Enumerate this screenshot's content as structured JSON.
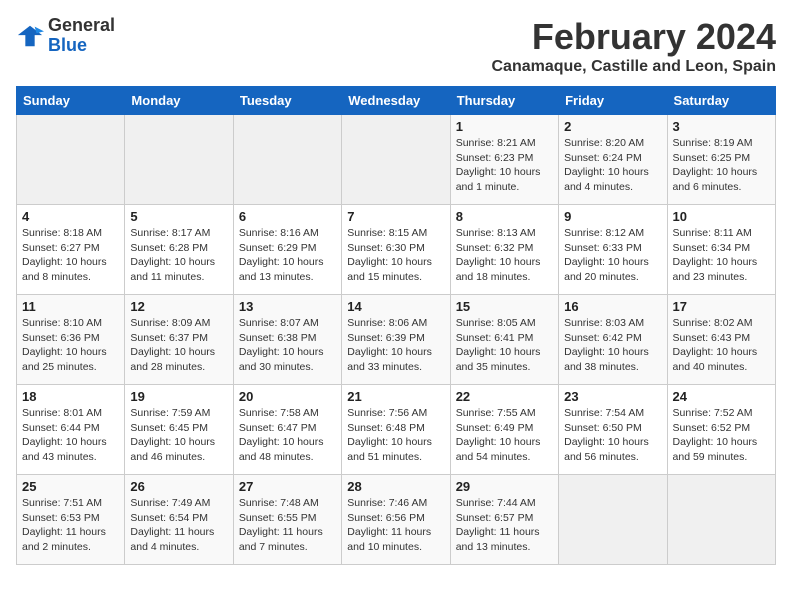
{
  "header": {
    "logo_line1": "General",
    "logo_line2": "Blue",
    "month_year": "February 2024",
    "location": "Canamaque, Castille and Leon, Spain"
  },
  "calendar": {
    "days_of_week": [
      "Sunday",
      "Monday",
      "Tuesday",
      "Wednesday",
      "Thursday",
      "Friday",
      "Saturday"
    ],
    "weeks": [
      [
        {
          "day": "",
          "info": ""
        },
        {
          "day": "",
          "info": ""
        },
        {
          "day": "",
          "info": ""
        },
        {
          "day": "",
          "info": ""
        },
        {
          "day": "1",
          "info": "Sunrise: 8:21 AM\nSunset: 6:23 PM\nDaylight: 10 hours and 1 minute."
        },
        {
          "day": "2",
          "info": "Sunrise: 8:20 AM\nSunset: 6:24 PM\nDaylight: 10 hours and 4 minutes."
        },
        {
          "day": "3",
          "info": "Sunrise: 8:19 AM\nSunset: 6:25 PM\nDaylight: 10 hours and 6 minutes."
        }
      ],
      [
        {
          "day": "4",
          "info": "Sunrise: 8:18 AM\nSunset: 6:27 PM\nDaylight: 10 hours and 8 minutes."
        },
        {
          "day": "5",
          "info": "Sunrise: 8:17 AM\nSunset: 6:28 PM\nDaylight: 10 hours and 11 minutes."
        },
        {
          "day": "6",
          "info": "Sunrise: 8:16 AM\nSunset: 6:29 PM\nDaylight: 10 hours and 13 minutes."
        },
        {
          "day": "7",
          "info": "Sunrise: 8:15 AM\nSunset: 6:30 PM\nDaylight: 10 hours and 15 minutes."
        },
        {
          "day": "8",
          "info": "Sunrise: 8:13 AM\nSunset: 6:32 PM\nDaylight: 10 hours and 18 minutes."
        },
        {
          "day": "9",
          "info": "Sunrise: 8:12 AM\nSunset: 6:33 PM\nDaylight: 10 hours and 20 minutes."
        },
        {
          "day": "10",
          "info": "Sunrise: 8:11 AM\nSunset: 6:34 PM\nDaylight: 10 hours and 23 minutes."
        }
      ],
      [
        {
          "day": "11",
          "info": "Sunrise: 8:10 AM\nSunset: 6:36 PM\nDaylight: 10 hours and 25 minutes."
        },
        {
          "day": "12",
          "info": "Sunrise: 8:09 AM\nSunset: 6:37 PM\nDaylight: 10 hours and 28 minutes."
        },
        {
          "day": "13",
          "info": "Sunrise: 8:07 AM\nSunset: 6:38 PM\nDaylight: 10 hours and 30 minutes."
        },
        {
          "day": "14",
          "info": "Sunrise: 8:06 AM\nSunset: 6:39 PM\nDaylight: 10 hours and 33 minutes."
        },
        {
          "day": "15",
          "info": "Sunrise: 8:05 AM\nSunset: 6:41 PM\nDaylight: 10 hours and 35 minutes."
        },
        {
          "day": "16",
          "info": "Sunrise: 8:03 AM\nSunset: 6:42 PM\nDaylight: 10 hours and 38 minutes."
        },
        {
          "day": "17",
          "info": "Sunrise: 8:02 AM\nSunset: 6:43 PM\nDaylight: 10 hours and 40 minutes."
        }
      ],
      [
        {
          "day": "18",
          "info": "Sunrise: 8:01 AM\nSunset: 6:44 PM\nDaylight: 10 hours and 43 minutes."
        },
        {
          "day": "19",
          "info": "Sunrise: 7:59 AM\nSunset: 6:45 PM\nDaylight: 10 hours and 46 minutes."
        },
        {
          "day": "20",
          "info": "Sunrise: 7:58 AM\nSunset: 6:47 PM\nDaylight: 10 hours and 48 minutes."
        },
        {
          "day": "21",
          "info": "Sunrise: 7:56 AM\nSunset: 6:48 PM\nDaylight: 10 hours and 51 minutes."
        },
        {
          "day": "22",
          "info": "Sunrise: 7:55 AM\nSunset: 6:49 PM\nDaylight: 10 hours and 54 minutes."
        },
        {
          "day": "23",
          "info": "Sunrise: 7:54 AM\nSunset: 6:50 PM\nDaylight: 10 hours and 56 minutes."
        },
        {
          "day": "24",
          "info": "Sunrise: 7:52 AM\nSunset: 6:52 PM\nDaylight: 10 hours and 59 minutes."
        }
      ],
      [
        {
          "day": "25",
          "info": "Sunrise: 7:51 AM\nSunset: 6:53 PM\nDaylight: 11 hours and 2 minutes."
        },
        {
          "day": "26",
          "info": "Sunrise: 7:49 AM\nSunset: 6:54 PM\nDaylight: 11 hours and 4 minutes."
        },
        {
          "day": "27",
          "info": "Sunrise: 7:48 AM\nSunset: 6:55 PM\nDaylight: 11 hours and 7 minutes."
        },
        {
          "day": "28",
          "info": "Sunrise: 7:46 AM\nSunset: 6:56 PM\nDaylight: 11 hours and 10 minutes."
        },
        {
          "day": "29",
          "info": "Sunrise: 7:44 AM\nSunset: 6:57 PM\nDaylight: 11 hours and 13 minutes."
        },
        {
          "day": "",
          "info": ""
        },
        {
          "day": "",
          "info": ""
        }
      ]
    ]
  }
}
